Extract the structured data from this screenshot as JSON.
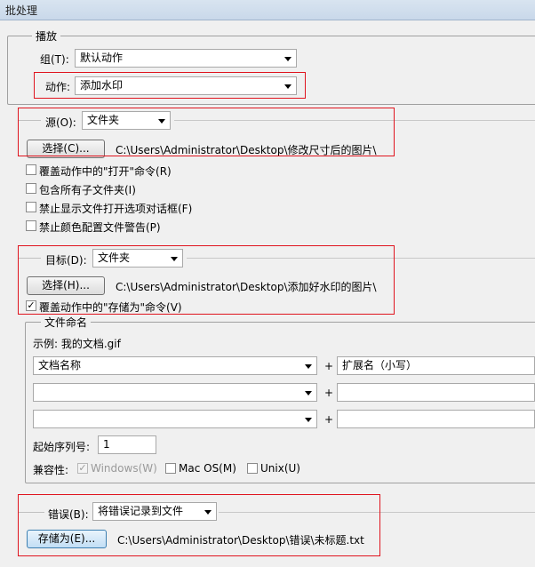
{
  "window": {
    "title": "批处理"
  },
  "play": {
    "section_label": "播放",
    "group_label": "组(T):",
    "group_value": "默认动作",
    "action_label": "动作:",
    "action_value": "添加水印"
  },
  "source": {
    "label": "源(O):",
    "value": "文件夹",
    "choose_button": "选择(C)...",
    "path": "C:\\Users\\Administrator\\Desktop\\修改尺寸后的图片\\",
    "options": [
      {
        "label": "覆盖动作中的\"打开\"命令(R)",
        "checked": false
      },
      {
        "label": "包含所有子文件夹(I)",
        "checked": false
      },
      {
        "label": "禁止显示文件打开选项对话框(F)",
        "checked": false
      },
      {
        "label": "禁止颜色配置文件警告(P)",
        "checked": false
      }
    ]
  },
  "destination": {
    "label": "目标(D):",
    "value": "文件夹",
    "choose_button": "选择(H)...",
    "path": "C:\\Users\\Administrator\\Desktop\\添加好水印的图片\\",
    "override_save": {
      "label": "覆盖动作中的\"存储为\"命令(V)",
      "checked": true
    }
  },
  "naming": {
    "section_label": "文件命名",
    "example": "示例: 我的文档.gif",
    "rows": [
      {
        "left": "文档名称",
        "right": "扩展名（小写）"
      },
      {
        "left": "",
        "right": ""
      },
      {
        "left": "",
        "right": ""
      }
    ],
    "plus": "+",
    "start_serial_label": "起始序列号:",
    "start_serial_value": "1",
    "compat_label": "兼容性:",
    "compat": [
      {
        "label": "Windows(W)",
        "checked": true,
        "disabled": true
      },
      {
        "label": "Mac OS(M)",
        "checked": false,
        "disabled": false
      },
      {
        "label": "Unix(U)",
        "checked": false,
        "disabled": false
      }
    ]
  },
  "errors": {
    "label": "错误(B):",
    "value": "将错误记录到文件",
    "save_button": "存储为(E)...",
    "path": "C:\\Users\\Administrator\\Desktop\\错误\\未标题.txt"
  }
}
